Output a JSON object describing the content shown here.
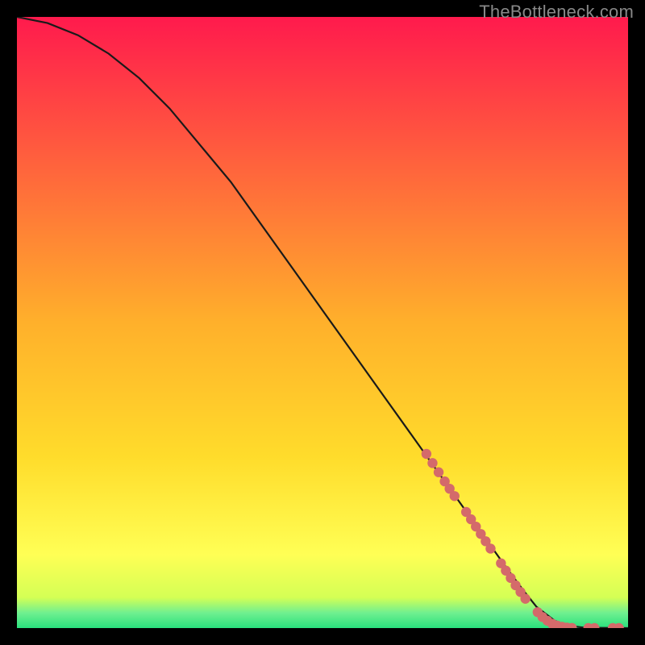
{
  "attribution": "TheBottleneck.com",
  "colors": {
    "top": "#ff1a4d",
    "mid": "#ffdc2b",
    "lowYellow": "#ffff55",
    "lowGreen": "#29e07d",
    "lineCurve": "#1a1a1a",
    "dot": "#d46a6a",
    "frame": "#000000"
  },
  "chart_data": {
    "type": "line",
    "title": "",
    "xlabel": "",
    "ylabel": "",
    "xlim": [
      0,
      100
    ],
    "ylim": [
      0,
      100
    ],
    "curve": {
      "x": [
        0,
        5,
        10,
        15,
        20,
        25,
        30,
        35,
        40,
        45,
        50,
        55,
        60,
        65,
        70,
        75,
        80,
        83,
        85,
        88,
        90,
        93,
        100
      ],
      "y": [
        100,
        99,
        97,
        94,
        90,
        85,
        79,
        73,
        66,
        59,
        52,
        45,
        38,
        31,
        24,
        17,
        10,
        6,
        3.5,
        1.2,
        0.4,
        0.05,
        0
      ]
    },
    "dots": [
      {
        "x": 67,
        "y": 28.5
      },
      {
        "x": 68,
        "y": 27
      },
      {
        "x": 69,
        "y": 25.5
      },
      {
        "x": 70,
        "y": 24
      },
      {
        "x": 70.8,
        "y": 22.8
      },
      {
        "x": 71.6,
        "y": 21.6
      },
      {
        "x": 73.5,
        "y": 19
      },
      {
        "x": 74.3,
        "y": 17.8
      },
      {
        "x": 75.1,
        "y": 16.6
      },
      {
        "x": 75.9,
        "y": 15.4
      },
      {
        "x": 76.7,
        "y": 14.2
      },
      {
        "x": 77.5,
        "y": 13
      },
      {
        "x": 79.2,
        "y": 10.6
      },
      {
        "x": 80,
        "y": 9.4
      },
      {
        "x": 80.8,
        "y": 8.2
      },
      {
        "x": 81.6,
        "y": 7
      },
      {
        "x": 82.4,
        "y": 5.9
      },
      {
        "x": 83.2,
        "y": 4.8
      },
      {
        "x": 85.2,
        "y": 2.6
      },
      {
        "x": 86,
        "y": 1.8
      },
      {
        "x": 86.8,
        "y": 1.2
      },
      {
        "x": 87.6,
        "y": 0.7
      },
      {
        "x": 88.4,
        "y": 0.4
      },
      {
        "x": 89.2,
        "y": 0.2
      },
      {
        "x": 90,
        "y": 0.08
      },
      {
        "x": 90.8,
        "y": 0.03
      },
      {
        "x": 93.5,
        "y": 0
      },
      {
        "x": 94.5,
        "y": 0
      },
      {
        "x": 97.5,
        "y": 0
      },
      {
        "x": 98.5,
        "y": 0
      }
    ]
  }
}
